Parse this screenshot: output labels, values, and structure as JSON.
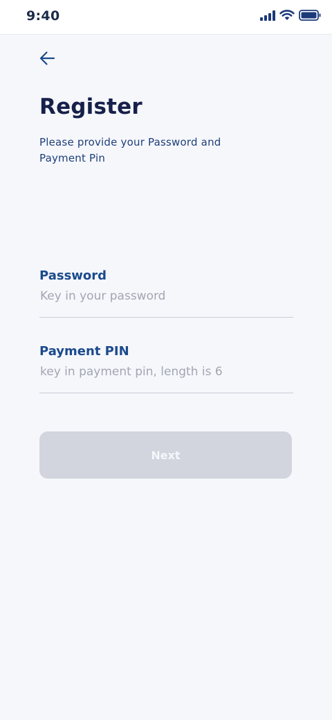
{
  "status_bar": {
    "time": "9:40",
    "icons": [
      "signal-icon",
      "wifi-icon",
      "battery-icon"
    ]
  },
  "header": {
    "back_icon": "arrow-left-icon"
  },
  "register": {
    "title": "Register",
    "subtitle": "Please provide your Password and Payment Pin"
  },
  "form": {
    "password": {
      "label": "Password",
      "placeholder": "Key in your password",
      "value": ""
    },
    "payment_pin": {
      "label": "Payment PIN",
      "placeholder": "key in payment pin, length is 6",
      "value": ""
    },
    "next_label": "Next"
  },
  "colors": {
    "accent": "#1b4a8c",
    "title": "#16204a",
    "background": "#f6f7fb",
    "button_disabled": "#d2d4de"
  }
}
